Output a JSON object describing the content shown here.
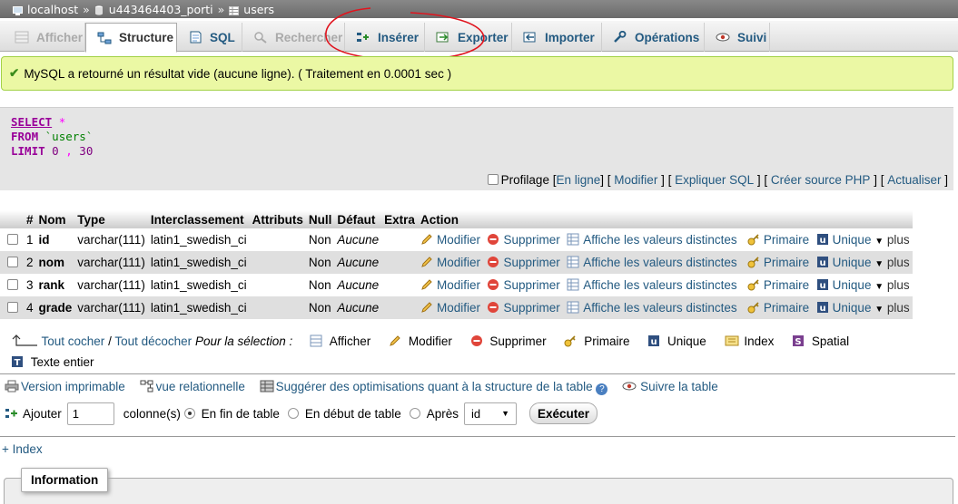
{
  "breadcrumb": {
    "server": "localhost",
    "database": "u443464403_porti",
    "table": "users",
    "separator": "»"
  },
  "tabs": [
    {
      "label": "Afficher",
      "icon": "table-browse-icon",
      "state": "disabled"
    },
    {
      "label": "Structure",
      "icon": "structure-icon",
      "state": "active"
    },
    {
      "label": "SQL",
      "icon": "sql-icon",
      "state": "normal"
    },
    {
      "label": "Rechercher",
      "icon": "magnifier-icon",
      "state": "disabled"
    },
    {
      "label": "Insérer",
      "icon": "insert-row-icon",
      "state": "normal"
    },
    {
      "label": "Exporter",
      "icon": "export-icon",
      "state": "normal"
    },
    {
      "label": "Importer",
      "icon": "import-icon",
      "state": "normal"
    },
    {
      "label": "Opérations",
      "icon": "wrench-icon",
      "state": "normal"
    },
    {
      "label": "Suivi",
      "icon": "eye-icon",
      "state": "normal"
    }
  ],
  "success_message": "MySQL a retourné un résultat vide (aucune ligne). ( Traitement en 0.0001 sec )",
  "sql": {
    "select": "SELECT",
    "star": "*",
    "from": "FROM",
    "table": "`users`",
    "limit": "LIMIT",
    "offset": "0",
    "comma": ",",
    "count": "30"
  },
  "profiling": {
    "label": "Profilage",
    "inline": "En ligne",
    "edit": "Modifier",
    "explain": "Expliquer SQL",
    "php": "Créer source PHP",
    "refresh": "Actualiser"
  },
  "table_headers": [
    "#",
    "Nom",
    "Type",
    "Interclassement",
    "Attributs",
    "Null",
    "Défaut",
    "Extra",
    "Action"
  ],
  "rows": [
    {
      "num": "1",
      "name": "id",
      "type": "varchar(111)",
      "collation": "latin1_swedish_ci",
      "attributes": "",
      "null": "Non",
      "default": "Aucune",
      "extra": ""
    },
    {
      "num": "2",
      "name": "nom",
      "type": "varchar(111)",
      "collation": "latin1_swedish_ci",
      "attributes": "",
      "null": "Non",
      "default": "Aucune",
      "extra": ""
    },
    {
      "num": "3",
      "name": "rank",
      "type": "varchar(111)",
      "collation": "latin1_swedish_ci",
      "attributes": "",
      "null": "Non",
      "default": "Aucune",
      "extra": ""
    },
    {
      "num": "4",
      "name": "grade",
      "type": "varchar(111)",
      "collation": "latin1_swedish_ci",
      "attributes": "",
      "null": "Non",
      "default": "Aucune",
      "extra": ""
    }
  ],
  "row_actions": {
    "edit": "Modifier",
    "delete": "Supprimer",
    "distinct": "Affiche les valeurs distinctes",
    "primary": "Primaire",
    "unique": "Unique",
    "more": "plus"
  },
  "selection": {
    "check_all": "Tout cocher",
    "slash": "/",
    "uncheck_all": "Tout décocher",
    "for_selection": "Pour la sélection :",
    "browse": "Afficher",
    "edit": "Modifier",
    "delete": "Supprimer",
    "primary": "Primaire",
    "unique": "Unique",
    "index": "Index",
    "spatial": "Spatial",
    "fulltext": "Texte entier"
  },
  "links": {
    "print": "Version imprimable",
    "relation": "vue relationnelle",
    "optimize": "Suggérer des optimisations quant à la structure de la table",
    "track": "Suivre la table"
  },
  "add_columns": {
    "add": "Ajouter",
    "count_value": "1",
    "columns": "colonne(s)",
    "at_end": "En fin de table",
    "at_start": "En début de table",
    "after": "Après",
    "after_field": "id",
    "go": "Exécuter"
  },
  "index_link": "+ Index",
  "info_legend": "Information",
  "colors": {
    "link": "#235a81",
    "success_bg": "#ebf8a4",
    "annotation": "#e0141e"
  }
}
